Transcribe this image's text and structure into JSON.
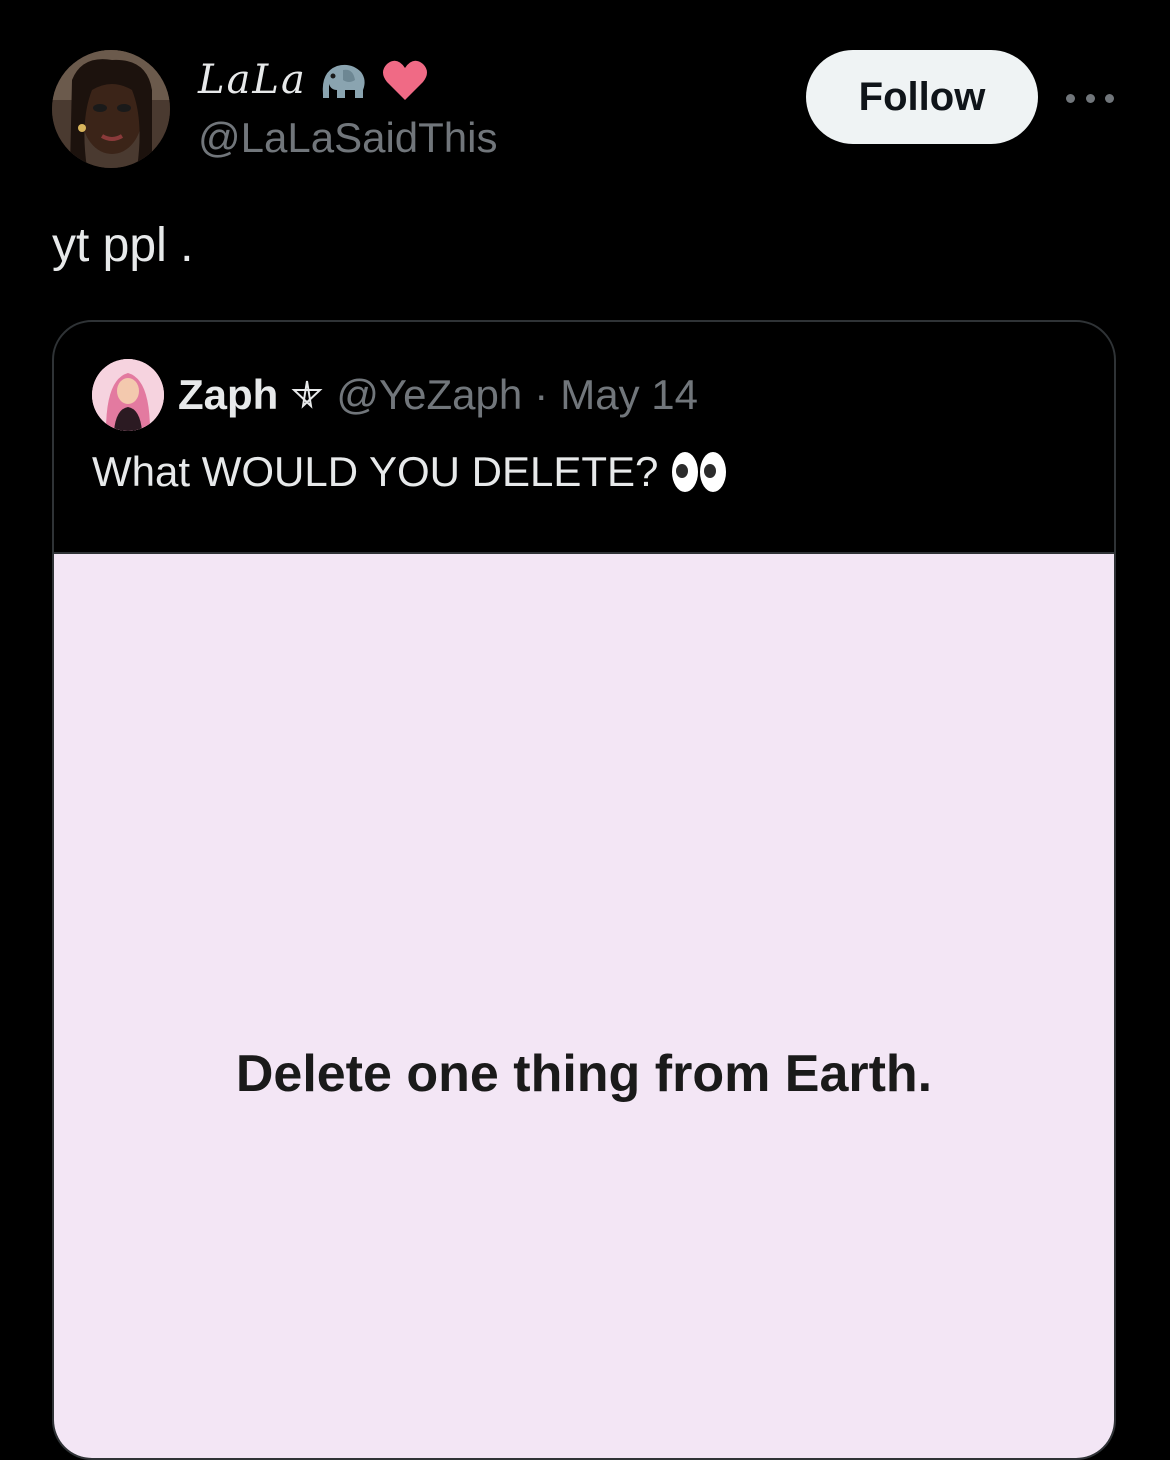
{
  "author": {
    "display_name": "LaLa",
    "name_emojis": [
      "elephant-emoji",
      "heart-emoji"
    ],
    "handle": "@LaLaSaidThis",
    "follow_label": "Follow"
  },
  "tweet": {
    "text": "yt ppl ."
  },
  "quote": {
    "name": "Zaph",
    "handle": "@YeZaph",
    "separator": "·",
    "date": "May 14",
    "text": "What WOULD YOU DELETE?",
    "text_emoji": "eyes-emoji",
    "media_text": "Delete one thing from Earth.",
    "media_bg": "#f3e6f5"
  },
  "colors": {
    "background": "#000000",
    "primary_text": "#e7e9ea",
    "secondary_text": "#71767b",
    "follow_bg": "#eff3f4",
    "border": "#2f3336"
  }
}
